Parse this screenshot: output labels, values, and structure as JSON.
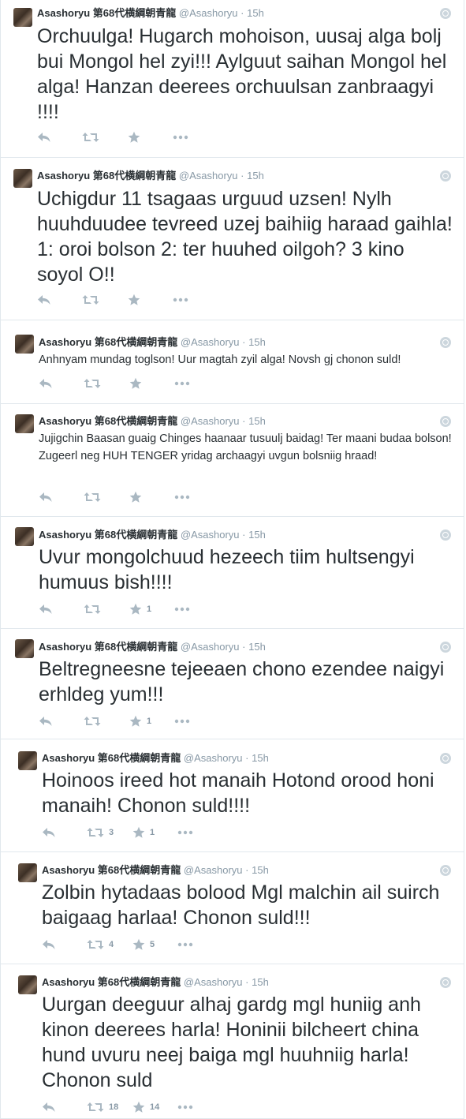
{
  "author": {
    "name": "Asashoryu 第68代横綱朝青龍",
    "handle": "@Asashoryu",
    "separator": "·",
    "time": "15h"
  },
  "tweets": [
    {
      "text": "Orchuulga! Hugarch mohoison, uusaj alga bolj bui Mongol hel zyi!!! Aylguut saihan Mongol hel alga! Hanzan deerees orchuulsan zanbraagyi !!!!",
      "retweets": "",
      "favorites": ""
    },
    {
      "text": "Uchigdur 11 tsagaas urguud uzsen! Nylh huuhduudee tevreed uzej baihiig haraad gaihla! 1: oroi bolson 2: ter huuhed oilgoh? 3 kino soyol O!!",
      "retweets": "",
      "favorites": ""
    },
    {
      "text": "Anhnyam mundag toglson! Uur magtah zyil alga! Novsh gj chonon suld!",
      "retweets": "",
      "favorites": ""
    },
    {
      "text": "Jujigchin Baasan guaig Chinges haanaar tusuulj baidag! Ter maani budaa bolson! Zugeerl neg HUH TENGER yridag archaagyi uvgun bolsniig hraad!",
      "retweets": "",
      "favorites": ""
    },
    {
      "text": "Uvur mongolchuud hezeech tiim hultsengyi humuus bish!!!!",
      "retweets": "",
      "favorites": "1"
    },
    {
      "text": "Beltregneesne tejeeaen chono ezendee naigyi erhldeg yum!!!",
      "retweets": "",
      "favorites": "1"
    },
    {
      "text": "Hoinoos ireed hot manaih Hotond orood honi manaih! Chonon suld!!!!",
      "retweets": "3",
      "favorites": "1"
    },
    {
      "text": "Zolbin hytadaas bolood Mgl malchin ail suirch baigaag harlaa! Chonon suld!!!",
      "retweets": "4",
      "favorites": "5"
    },
    {
      "text": "Uurgan deeguur alhaj gardg mgl huniig anh kinon deerees harla! Honinii bilcheert china hund uvuru neej baiga mgl huuhniig harla! Chonon suld",
      "retweets": "18",
      "favorites": "14"
    }
  ],
  "icons": {
    "reply": "reply-icon",
    "retweet": "retweet-icon",
    "favorite": "star-icon",
    "more": "more-icon",
    "globe": "globe-icon"
  },
  "colors": {
    "text": "#292f33",
    "muted": "#8899a6",
    "icon": "#aab8c2",
    "border": "#e1e8ed"
  }
}
